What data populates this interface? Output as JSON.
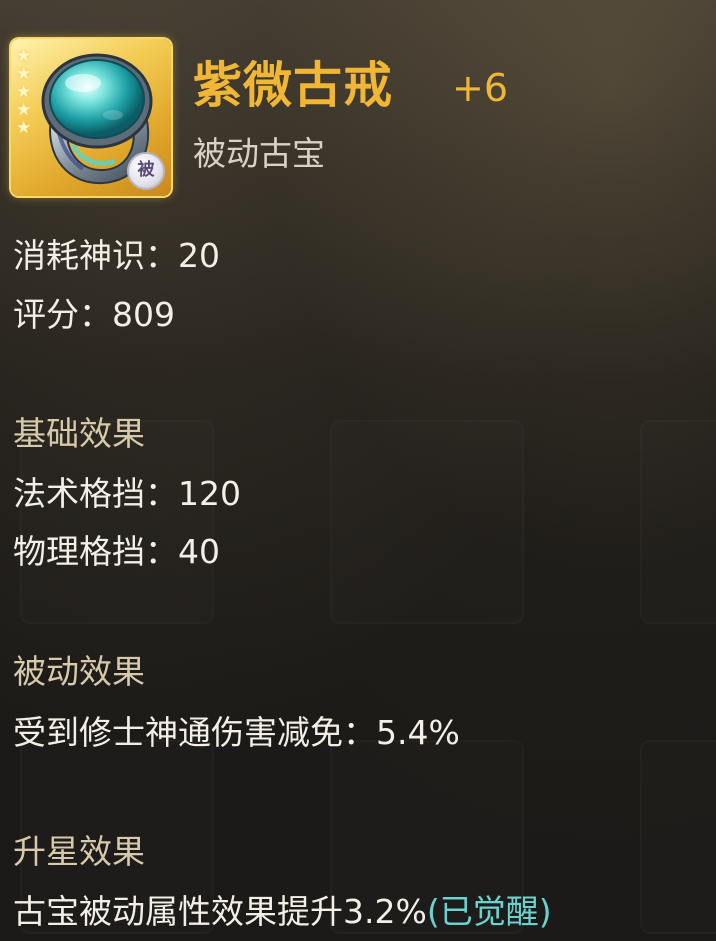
{
  "item": {
    "name": "紫微古戒",
    "level": "+6",
    "type": "被动古宝",
    "stars": 5,
    "badge": "被",
    "rarity_color": "#f0b636"
  },
  "stats": {
    "consumption_label": "消耗神识：",
    "consumption_value": "20",
    "score_label": "评分：",
    "score_value": "809"
  },
  "base_effect": {
    "heading": "基础效果",
    "rows": [
      {
        "label": "法术格挡：",
        "value": "120"
      },
      {
        "label": "物理格挡：",
        "value": "40"
      }
    ]
  },
  "passive_effect": {
    "heading": "被动效果",
    "rows": [
      {
        "label": "受到修士神通伤害减免：",
        "value": "5.4%"
      }
    ]
  },
  "star_effect": {
    "heading": "升星效果",
    "text": "古宝被动属性效果提升3.2%",
    "status": "(已觉醒)",
    "status_color": "#6bd2cf"
  },
  "icons": {
    "item": "jade-ring-icon",
    "star": "star-icon",
    "badge": "passive-badge-icon"
  }
}
